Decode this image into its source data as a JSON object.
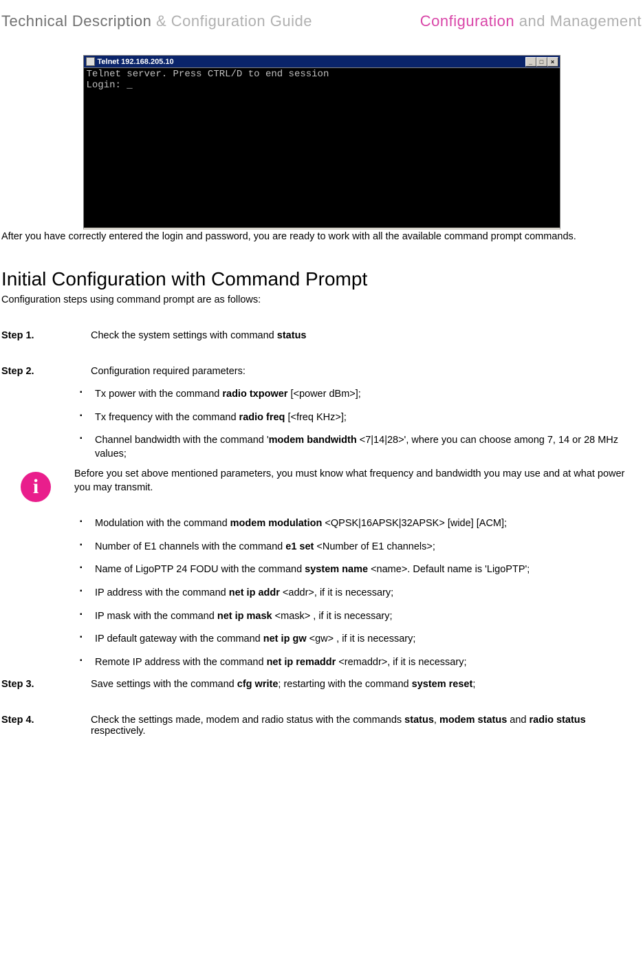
{
  "header": {
    "leftDark": "Technical Description",
    "leftLight": " & Configuration Guide",
    "rightPink": "Configuration",
    "rightGrey": " and Management"
  },
  "telnet": {
    "title": "Telnet 192.168.205.10",
    "min": "_",
    "max": "□",
    "close": "×",
    "line1": "Telnet server. Press CTRL/D to end session",
    "line2": "Login: _"
  },
  "afterTelnet": "After you have correctly entered the login and password, you are ready to work with all the available command prompt commands.",
  "sectionTitle": "Initial Configuration with Command Prompt",
  "sectionIntro": "Configuration steps using command prompt are as follows:",
  "steps": {
    "s1": {
      "label": "Step 1.",
      "pre": "Check the system settings with command ",
      "cmd": "status"
    },
    "s2": {
      "label": "Step 2.",
      "text": "Configuration required parameters:"
    },
    "s3": {
      "label": "Step 3.",
      "t1": "Save settings with the command ",
      "c1": "cfg write",
      "t2": "; restarting with the command ",
      "c2": "system reset",
      "t3": ";"
    },
    "s4": {
      "label": "Step 4.",
      "t1": "Check the settings made, modem and radio status with the commands ",
      "c1": "status",
      "t2": ", ",
      "c2": "modem status",
      "t3": " and ",
      "c3": "radio status",
      "t4": " respectively."
    }
  },
  "bulletsA": {
    "b1": {
      "t1": "Tx power with the command ",
      "c1": "radio txpower",
      "t2": " [<power dBm>];"
    },
    "b2": {
      "t1": "Tx frequency with the command ",
      "c1": "radio freq",
      "t2": " [<freq KHz>];"
    },
    "b3": {
      "t1": "Channel bandwidth with the command '",
      "c1": "modem bandwidth",
      "t2": " <7|14|28>', where you can choose among 7, 14 or 28 MHz values;"
    }
  },
  "info": {
    "icon": "i",
    "text": "Before you set above mentioned parameters, you must know what frequency and bandwidth you may use and at what power you may transmit."
  },
  "bulletsB": {
    "b1": {
      "t1": "Modulation with the command ",
      "c1": "modem modulation",
      "t2": " <QPSK|16APSK|32APSK> [wide] [ACM];"
    },
    "b2": {
      "t1": "Number of E1 channels with the command ",
      "c1": "e1 set",
      "t2": " <Number of E1 channels>;"
    },
    "b3": {
      "t1": "Name of LigoPTP 24 FODU with the command ",
      "c1": "system name",
      "t2": " <name>. Default name is 'LigoPTP';"
    },
    "b4": {
      "t1": "IP address with the command ",
      "c1": "net ip addr",
      "t2": " <addr>, if it is necessary;"
    },
    "b5": {
      "t1": "IP mask with the command ",
      "c1": "net ip mask",
      "t2": " <mask> , if it is necessary;"
    },
    "b6": {
      "t1": "IP default gateway with the command ",
      "c1": "net ip gw",
      "t2": " <gw> , if it is necessary;"
    },
    "b7": {
      "t1": "Remote IP address with the command ",
      "c1": "net ip remaddr",
      "t2": " <remaddr>, if it is necessary;"
    }
  }
}
